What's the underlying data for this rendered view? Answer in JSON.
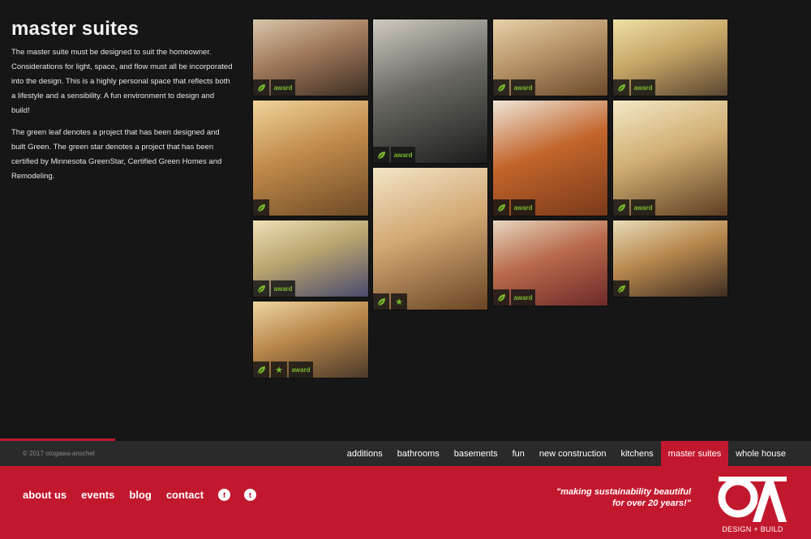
{
  "page": {
    "title": "master suites",
    "paragraphs": [
      "The master suite must be designed to suit the homeowner. Considerations for light, space, and flow must all be incorporated into the design. This is a highly personal space that reflects both a lifestyle and a sensibility. A fun environment to design and build!",
      "The green leaf denotes a project that has been designed and built Green. The green star denotes a project that has been certified by Minnesota GreenStar, Certified Green Homes and Remodeling."
    ]
  },
  "gallery": {
    "award_label": "award",
    "tiles": [
      {
        "leaf": true,
        "star": false,
        "award": true,
        "photo": "attic bedroom"
      },
      {
        "leaf": true,
        "star": false,
        "award": true,
        "photo": "bathroom vanity"
      },
      {
        "leaf": true,
        "star": false,
        "award": true,
        "photo": "built-in shelves"
      },
      {
        "leaf": true,
        "star": false,
        "award": true,
        "photo": "bedroom ceiling fan"
      },
      {
        "leaf": true,
        "star": false,
        "award": false,
        "photo": "attic loft bedroom"
      },
      {
        "leaf": true,
        "star": true,
        "award": false,
        "photo": "stair niche"
      },
      {
        "leaf": true,
        "star": false,
        "award": true,
        "photo": "orange bedroom"
      },
      {
        "leaf": true,
        "star": false,
        "award": true,
        "photo": "yellow attic bedroom"
      },
      {
        "leaf": true,
        "star": false,
        "award": true,
        "photo": "purple wall bedroom"
      },
      {
        "leaf": true,
        "star": false,
        "award": true,
        "photo": "red chair bedroom"
      },
      {
        "leaf": true,
        "star": false,
        "award": false,
        "photo": "bedroom with wood floor"
      },
      {
        "leaf": true,
        "star": true,
        "award": true,
        "photo": "hallway dining"
      }
    ]
  },
  "footer": {
    "copyright": "© 2017 otogawa-anschel",
    "categories": [
      "additions",
      "bathrooms",
      "basements",
      "fun",
      "new construction",
      "kitchens",
      "master suites",
      "whole house"
    ],
    "active_category": "master suites",
    "links": [
      "about us",
      "events",
      "blog",
      "contact"
    ],
    "social": [
      {
        "name": "facebook-icon",
        "glyph": "f"
      },
      {
        "name": "twitter-icon",
        "glyph": "t"
      }
    ],
    "slogan_line1": "\"making sustainability beautiful",
    "slogan_line2": "for over 20 years!\"",
    "logo_text": "DESIGN + BUILD"
  },
  "colors": {
    "background": "#161616",
    "brand_red": "#c2182e",
    "leaf_green": "#7ab82b",
    "nav_bar": "#2a2a2a"
  }
}
